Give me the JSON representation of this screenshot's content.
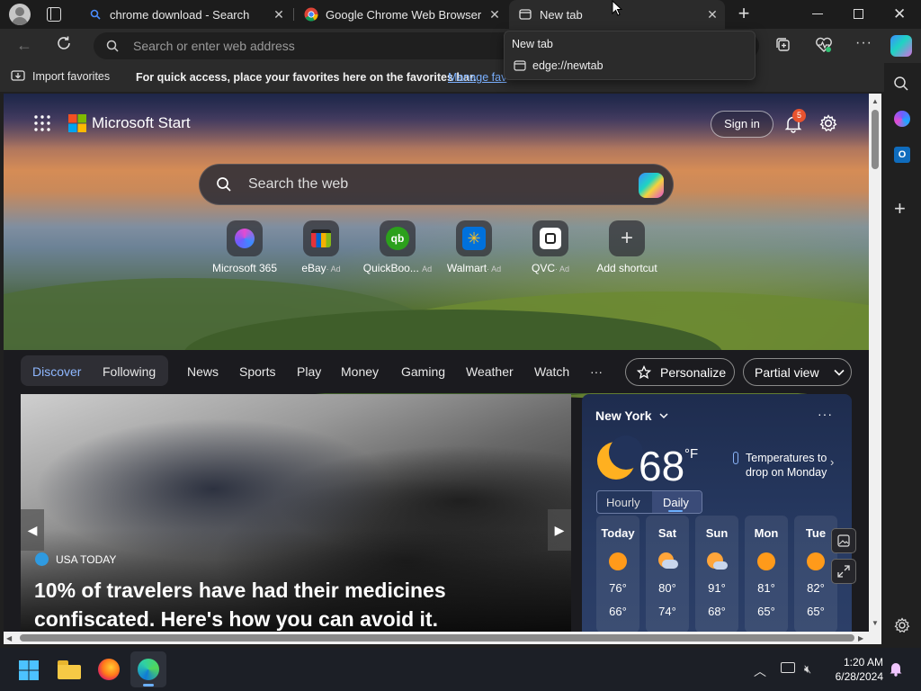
{
  "tabs": [
    {
      "title": "chrome download - Search"
    },
    {
      "title": "Google Chrome Web Browser"
    },
    {
      "title": "New tab"
    }
  ],
  "address": {
    "placeholder": "Search or enter web address"
  },
  "tab_tooltip": {
    "title": "New tab",
    "url": "edge://newtab"
  },
  "favorites_bar": {
    "import_label": "Import favorites",
    "hint": "For quick access, place your favorites here on the favorites bar.",
    "manage_link": "Manage fav"
  },
  "ms_start": {
    "brand": "Microsoft Start",
    "sign_in": "Sign in",
    "notifications": "5",
    "search_placeholder": "Search the web",
    "shortcuts": [
      {
        "label": "Microsoft 365",
        "ad": ""
      },
      {
        "label": "eBay",
        "ad": "· Ad"
      },
      {
        "label": "QuickBoo...",
        "ad": "Ad"
      },
      {
        "label": "Walmart",
        "ad": "· Ad"
      },
      {
        "label": "QVC",
        "ad": "· Ad"
      },
      {
        "label": "Add shortcut",
        "ad": ""
      }
    ],
    "nav": [
      "Discover",
      "Following",
      "News",
      "Sports",
      "Play",
      "Money",
      "Gaming",
      "Weather",
      "Watch",
      "···"
    ],
    "personalize": "Personalize",
    "view_mode": "Partial view"
  },
  "news": {
    "source": "USA TODAY",
    "headline_line1": "10% of travelers have had their medicines",
    "headline_line2": "confiscated. Here's how you can avoid it."
  },
  "weather": {
    "city": "New York",
    "temp": "68",
    "unit": "°F",
    "alert_line1": "Temperatures to",
    "alert_line2": "drop on Monday",
    "toggle": [
      "Hourly",
      "Daily"
    ],
    "days": [
      {
        "day": "Today",
        "high": "76°",
        "low": "66°",
        "icon": "sun"
      },
      {
        "day": "Sat",
        "high": "80°",
        "low": "74°",
        "icon": "partly-cloudy"
      },
      {
        "day": "Sun",
        "high": "91°",
        "low": "68°",
        "icon": "partly-cloudy"
      },
      {
        "day": "Mon",
        "high": "81°",
        "low": "65°",
        "icon": "sun"
      },
      {
        "day": "Tue",
        "high": "82°",
        "low": "65°",
        "icon": "sun"
      }
    ]
  },
  "clock": {
    "time": "1:20 AM",
    "date": "6/28/2024"
  }
}
